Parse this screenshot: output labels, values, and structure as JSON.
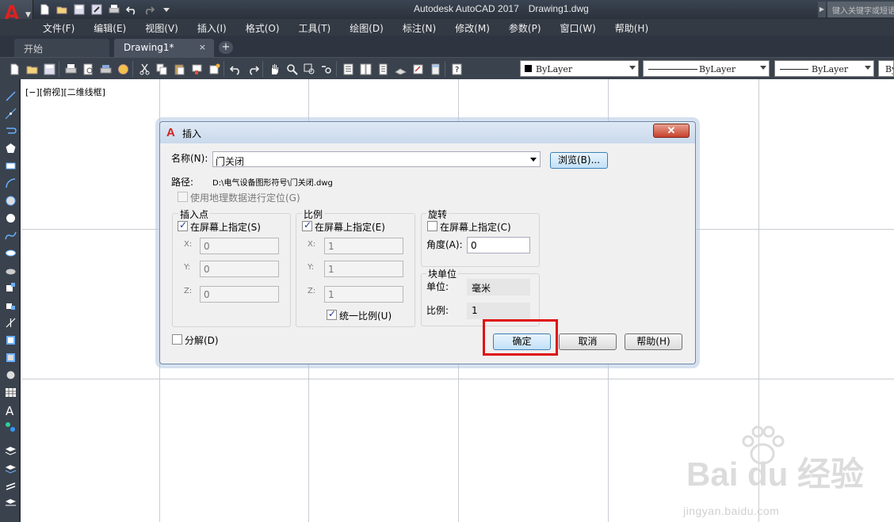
{
  "window": {
    "app_title": "Autodesk AutoCAD 2017",
    "doc_title": "Drawing1.dwg",
    "search_placeholder": "键入关键字或短语"
  },
  "menu": [
    "文件(F)",
    "编辑(E)",
    "视图(V)",
    "插入(I)",
    "格式(O)",
    "工具(T)",
    "绘图(D)",
    "标注(N)",
    "修改(M)",
    "参数(P)",
    "窗口(W)",
    "帮助(H)"
  ],
  "tabs": {
    "start": "开始",
    "drawing": "Drawing1*",
    "close_glyph": "×",
    "add_glyph": "+"
  },
  "properties": {
    "color": "ByLayer",
    "linetype": "ByLayer",
    "lineweight": "ByLayer",
    "plotstyle": "By"
  },
  "viewport": {
    "label": "[−][俯视][二维线框]"
  },
  "watermark": {
    "main": "Bai du 经验",
    "sub": "jingyan.baidu.com"
  },
  "dialog": {
    "title": "插入",
    "close_glyph": "✕",
    "name_label": "名称(N):",
    "name_value": "门关闭",
    "browse_label": "浏览(B)...",
    "path_label": "路径:",
    "path_value": "D:\\电气设备图形符号\\门关闭.dwg",
    "geo_label": "使用地理数据进行定位(G)",
    "insertion": {
      "title": "插入点",
      "onscreen_label": "在屏幕上指定(S)",
      "onscreen_checked": true,
      "x_label": "X:",
      "x_value": "0",
      "y_label": "Y:",
      "y_value": "0",
      "z_label": "Z:",
      "z_value": "0"
    },
    "scale": {
      "title": "比例",
      "onscreen_label": "在屏幕上指定(E)",
      "onscreen_checked": true,
      "x_label": "X:",
      "x_value": "1",
      "y_label": "Y:",
      "y_value": "1",
      "z_label": "Z:",
      "z_value": "1",
      "uniform_label": "统一比例(U)",
      "uniform_checked": true
    },
    "rotation": {
      "title": "旋转",
      "onscreen_label": "在屏幕上指定(C)",
      "onscreen_checked": false,
      "angle_label": "角度(A):",
      "angle_value": "0"
    },
    "block_unit": {
      "title": "块单位",
      "unit_label": "单位:",
      "unit_value": "毫米",
      "factor_label": "比例:",
      "factor_value": "1"
    },
    "explode_label": "分解(D)",
    "ok_label": "确定",
    "cancel_label": "取消",
    "help_label": "帮助(H)"
  },
  "colors": {
    "highlight": "#e01010",
    "app_red": "#d31f1f"
  }
}
